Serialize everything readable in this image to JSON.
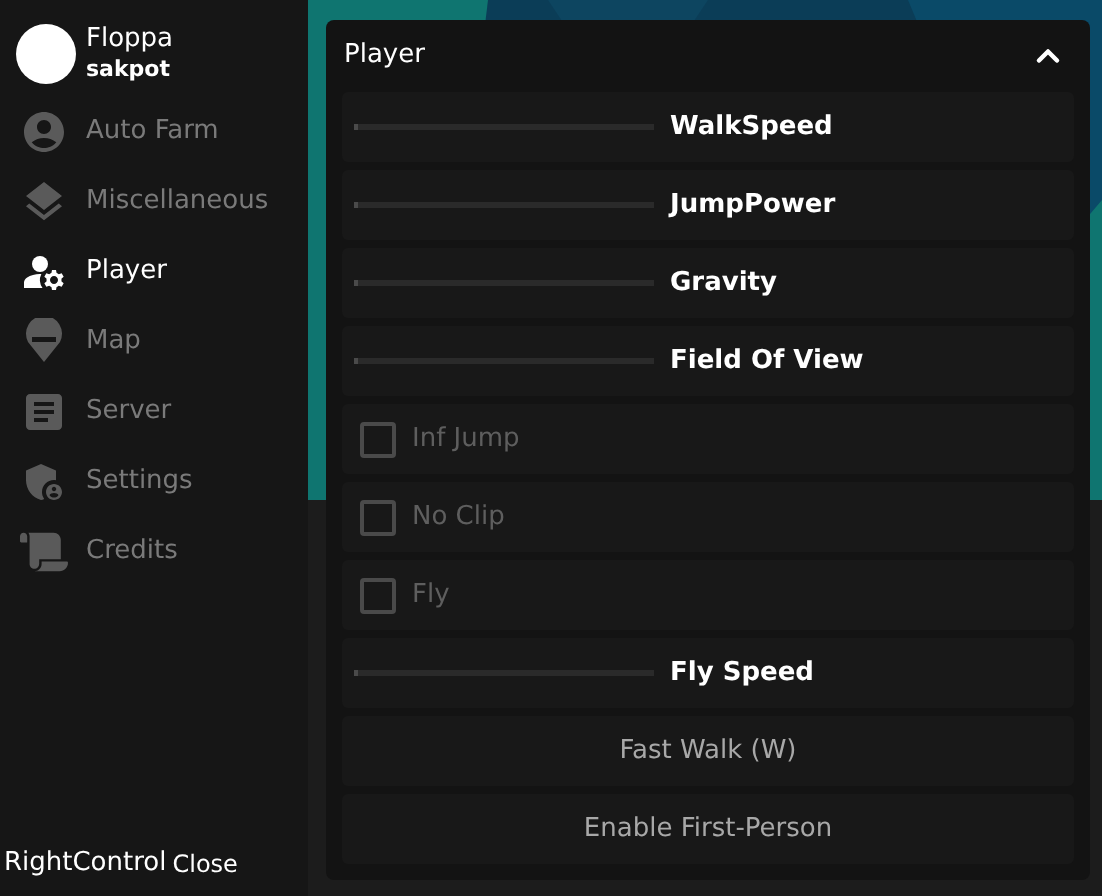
{
  "sidebar": {
    "user": {
      "name": "Floppa",
      "handle": "sakpot"
    },
    "items": [
      {
        "label": "Auto Farm",
        "selected": false
      },
      {
        "label": "Miscellaneous",
        "selected": false
      },
      {
        "label": "Player",
        "selected": true
      },
      {
        "label": "Map",
        "selected": false
      },
      {
        "label": "Server",
        "selected": false
      },
      {
        "label": "Settings",
        "selected": false
      },
      {
        "label": "Credits",
        "selected": false
      }
    ]
  },
  "panel": {
    "title": "Player",
    "expanded": true,
    "rows": [
      {
        "kind": "slider",
        "label": "WalkSpeed",
        "level": 0
      },
      {
        "kind": "slider",
        "label": "JumpPower",
        "level": 0
      },
      {
        "kind": "slider",
        "label": "Gravity",
        "level": 0
      },
      {
        "kind": "slider",
        "label": "Field Of View",
        "level": 0
      },
      {
        "kind": "checkbox",
        "label": "Inf Jump",
        "checked": false
      },
      {
        "kind": "checkbox",
        "label": "No Clip",
        "checked": false
      },
      {
        "kind": "checkbox",
        "label": "Fly",
        "checked": false
      },
      {
        "kind": "slider",
        "label": "Fly Speed",
        "level": 0
      },
      {
        "kind": "button",
        "label": "Fast Walk (W)"
      },
      {
        "kind": "button",
        "label": "Enable First-Person"
      }
    ]
  },
  "footer": {
    "keybind": "RightControl",
    "action": "Close"
  }
}
